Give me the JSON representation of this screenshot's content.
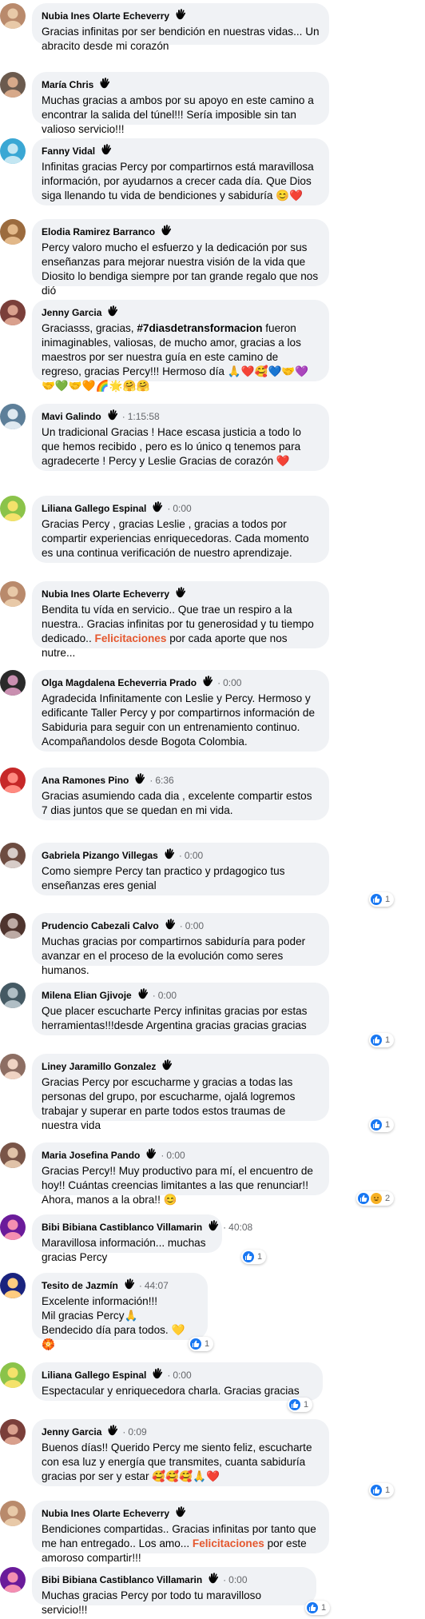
{
  "comments": [
    {
      "name": "Nubia Ines Olarte Echeverry",
      "time": "",
      "text": "Gracias infinitas por ser bendición en nuestras vidas... Un abracito desde mi corazón"
    },
    {
      "name": "María Chris",
      "time": "",
      "text": "Muchas gracias a ambos por su apoyo en este camino a encontrar la salida del túnel!!! Sería imposible sin tan valioso servicio!!!"
    },
    {
      "name": "Fanny Vidal",
      "time": "",
      "text": "Infinitas gracias Percy por compartirnos está maravillosa información, por ayudarnos a crecer cada día. Que Dios siga llenando tu vida de bendiciones y sabiduría 😊❤️"
    },
    {
      "name": "Elodia Ramirez Barranco",
      "time": "",
      "text": "Percy valoro mucho el esfuerzo y la dedicación por sus enseñanzas para mejorar nuestra visión de la vida que Diosito lo bendiga siempre por tan grande regalo que nos dió"
    },
    {
      "name": "Jenny Garcia",
      "time": "",
      "text_before": "Graciasss, gracias, ",
      "text_bold": "#7diasdetransformacion",
      "text_after": " fueron inimaginables, valiosas, de mucho amor, gracias a los maestros por ser nuestra guía en este camino de regreso, gracias Percy!!! Hermoso día 🙏❤️🥰💙🤝💜🤝💚🤝🧡🌈🌟🤗🤗"
    },
    {
      "name": "Mavi Galindo",
      "time": "1:15:58",
      "text": "Un tradicional Gracias ! Hace escasa justicia a todo lo que hemos recibido , pero es lo único q tenemos para agradecerte ! Percy y Leslie Gracias de corazón ❤️"
    },
    {
      "name": "Liliana Gallego Espinal",
      "time": "0:00",
      "text": "Gracias Percy , gracias Leslie , gracias a todos por compartir experiencias enriquecedoras. Cada momento es una continua verificación de nuestro aprendizaje."
    },
    {
      "name": "Nubia Ines Olarte Echeverry",
      "time": "",
      "text_before": "Bendita tu vída en servicio.. Que trae un respiro a la nuestra.. Gracias infinitas por tu generosidad y tu tiempo dedicado.. ",
      "text_highlight": "Felicitaciones",
      "text_after": " por cada aporte que nos nutre..."
    },
    {
      "name": "Olga Magdalena Echeverria Prado",
      "time": "0:00",
      "text": "Agradecida Infinitamente con Leslie y Percy. Hermoso y edificante Taller Percy y por compartirnos información de Sabiduria para seguir con un entrenamiento continuo. Acompañandolos desde Bogota Colombia."
    },
    {
      "name": "Ana Ramones Pino",
      "time": "6:36",
      "text": "Gracias asumiendo cada dia , excelente compartir estos 7 dias juntos que se quedan en mi vida."
    },
    {
      "name": "Gabriela Pizango Villegas",
      "time": "0:00",
      "text": "Como siempre Percy tan practico y prdagogico tus enseñanzas eres genial",
      "reaction_count": "1"
    },
    {
      "name": "Prudencio Cabezali Calvo",
      "time": "0:00",
      "text": "Muchas gracias por compartirnos sabiduría para poder avanzar en el proceso de la evolución como seres humanos."
    },
    {
      "name": "Milena Elian Gjivoje",
      "time": "0:00",
      "text": "Que placer escucharte Percy infinitas gracias por estas herramientas!!!desde Argentina gracias gracias gracias",
      "reaction_count": "1"
    },
    {
      "name": "Liney Jaramillo Gonzalez",
      "time": "",
      "text": "Gracias Percy por escucharme y gracias a todas las personas del grupo, por escucharme, ojalá logremos trabajar y superar en parte todos estos traumas de nuestra vida",
      "reaction_count": "1"
    },
    {
      "name": "Maria Josefina Pando",
      "time": "0:00",
      "text": "Gracias Percy!! Muy productivo para mí, el encuentro de hoy!! Cuántas creencias limitantes a las que renunciar!! Ahora, manos a la obra!! 😊",
      "reaction_count": "2"
    },
    {
      "name": "Bibi Bibiana Castiblanco Villamarin",
      "time": "40:08",
      "text": "Maravillosa información... muchas gracias Percy",
      "reaction_count": "1"
    },
    {
      "name": "Tesito de Jazmín",
      "time": "44:07",
      "text": "Excelente información!!!\nMil gracias Percy🙏\nBendecido día para todos. 💛🏵️",
      "reaction_count": "1"
    },
    {
      "name": "Liliana Gallego Espinal",
      "time": "0:00",
      "text": "Espectacular y enriquecedora charla. Gracias gracias",
      "reaction_count": "1"
    },
    {
      "name": "Jenny Garcia",
      "time": "0:09",
      "text": "Buenos días!! Querido Percy me siento feliz, escucharte con esa luz y energía que transmites, cuanta sabiduría gracias por ser y estar 🥰🥰🥰🙏❤️",
      "reaction_count": "1"
    },
    {
      "name": "Nubia Ines Olarte Echeverry",
      "time": "",
      "text_before": "Bendiciones compartidas.. Gracias infinitas por tanto que me han entregado.. Los amo... ",
      "text_highlight": "Felicitaciones",
      "text_after": " por este amoroso compartir!!!"
    },
    {
      "name": "Bibi Bibiana Castiblanco Villamarin",
      "time": "0:00",
      "text": "Muchas gracias Percy por todo tu maravilloso servicio!!!",
      "reaction_count": "1"
    }
  ],
  "avatars": [
    {
      "bg": "#b98a6c",
      "fg": "#e8c9a8"
    },
    {
      "bg": "#6b5a4e",
      "fg": "#d7a98a"
    },
    {
      "bg": "#3aa7d4",
      "fg": "#c3e6f2"
    },
    {
      "bg": "#9b6b3e",
      "fg": "#e2b889"
    },
    {
      "bg": "#7a3f3a",
      "fg": "#d9a08d"
    },
    {
      "bg": "#5d7f99",
      "fg": "#dfe9f0"
    },
    {
      "bg": "#8bc34a",
      "fg": "#f4e26b"
    },
    {
      "bg": "#b98a6c",
      "fg": "#e8c9a8"
    },
    {
      "bg": "#2a2a2a",
      "fg": "#c98fb0"
    },
    {
      "bg": "#c62828",
      "fg": "#ff8a80"
    },
    {
      "bg": "#6d4c41",
      "fg": "#d7ccc8"
    },
    {
      "bg": "#4e342e",
      "fg": "#bcaaa4"
    },
    {
      "bg": "#455a64",
      "fg": "#b0bec5"
    },
    {
      "bg": "#8d6e63",
      "fg": "#efd3c3"
    },
    {
      "bg": "#795548",
      "fg": "#e0c2a8"
    },
    {
      "bg": "#6a1b9a",
      "fg": "#f48fb1"
    },
    {
      "bg": "#1a237e",
      "fg": "#ffcc80"
    },
    {
      "bg": "#8bc34a",
      "fg": "#f4e26b"
    },
    {
      "bg": "#7a3f3a",
      "fg": "#d9a08d"
    },
    {
      "bg": "#b98a6c",
      "fg": "#e8c9a8"
    },
    {
      "bg": "#6a1b9a",
      "fg": "#f48fb1"
    }
  ],
  "colors": {
    "bubble": "#f0f2f5",
    "name": "#050505",
    "meta": "#65676b",
    "link": "#e4572e",
    "like": "#1877f2"
  }
}
